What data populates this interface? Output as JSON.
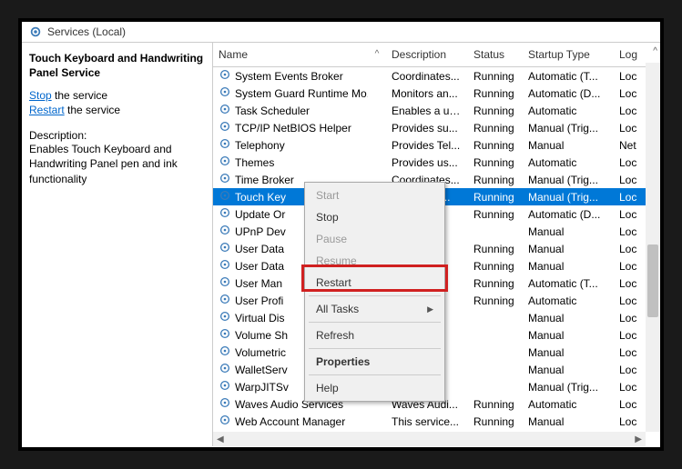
{
  "titlebar": {
    "text": "Services (Local)"
  },
  "leftPane": {
    "serviceTitle": "Touch Keyboard and Handwriting Panel Service",
    "stopLink": "Stop",
    "stopSuffix": " the service",
    "restartLink": "Restart",
    "restartSuffix": " the service",
    "descLabel": "Description:",
    "descText": "Enables Touch Keyboard and Handwriting Panel pen and ink functionality"
  },
  "headers": {
    "name": "Name",
    "description": "Description",
    "status": "Status",
    "startup": "Startup Type",
    "log": "Log"
  },
  "rows": [
    {
      "name": "System Events Broker",
      "desc": "Coordinates...",
      "status": "Running",
      "startup": "Automatic (T...",
      "log": "Loc"
    },
    {
      "name": "System Guard Runtime Mo...",
      "desc": "Monitors an...",
      "status": "Running",
      "startup": "Automatic (D...",
      "log": "Loc"
    },
    {
      "name": "Task Scheduler",
      "desc": "Enables a us...",
      "status": "Running",
      "startup": "Automatic",
      "log": "Loc"
    },
    {
      "name": "TCP/IP NetBIOS Helper",
      "desc": "Provides su...",
      "status": "Running",
      "startup": "Manual (Trig...",
      "log": "Loc"
    },
    {
      "name": "Telephony",
      "desc": "Provides Tel...",
      "status": "Running",
      "startup": "Manual",
      "log": "Net"
    },
    {
      "name": "Themes",
      "desc": "Provides us...",
      "status": "Running",
      "startup": "Automatic",
      "log": "Loc"
    },
    {
      "name": "Time Broker",
      "desc": "Coordinates...",
      "status": "Running",
      "startup": "Manual (Trig...",
      "log": "Loc"
    },
    {
      "name": "Touch Key",
      "desc": "...ides Tou...",
      "status": "Running",
      "startup": "Manual (Trig...",
      "log": "Loc",
      "selected": true
    },
    {
      "name": "Update Or",
      "desc": "es W...",
      "status": "Running",
      "startup": "Automatic (D...",
      "log": "Loc"
    },
    {
      "name": "UPnP Dev",
      "desc": "UPn...",
      "status": "",
      "startup": "Manual",
      "log": "Loc"
    },
    {
      "name": "User Data",
      "desc": "es ap...",
      "status": "Running",
      "startup": "Manual",
      "log": "Loc"
    },
    {
      "name": "User Data",
      "desc": "s sto...",
      "status": "Running",
      "startup": "Manual",
      "log": "Loc"
    },
    {
      "name": "User Man",
      "desc": "ana...",
      "status": "Running",
      "startup": "Automatic (T...",
      "log": "Loc"
    },
    {
      "name": "User Profi",
      "desc": "ice...",
      "status": "Running",
      "startup": "Automatic",
      "log": "Loc"
    },
    {
      "name": "Virtual Dis",
      "desc": "es m...",
      "status": "",
      "startup": "Manual",
      "log": "Loc"
    },
    {
      "name": "Volume Sh",
      "desc": "es an...",
      "status": "",
      "startup": "Manual",
      "log": "Loc"
    },
    {
      "name": "Volumetric",
      "desc": "patia...",
      "status": "",
      "startup": "Manual",
      "log": "Loc"
    },
    {
      "name": "WalletServ",
      "desc": "bjec...",
      "status": "",
      "startup": "Manual",
      "log": "Loc"
    },
    {
      "name": "WarpJITSv",
      "desc": "es a JI...",
      "status": "",
      "startup": "Manual (Trig...",
      "log": "Loc"
    },
    {
      "name": "Waves Audio Services",
      "desc": "Waves Audi...",
      "status": "Running",
      "startup": "Automatic",
      "log": "Loc"
    },
    {
      "name": "Web Account Manager",
      "desc": "This service...",
      "status": "Running",
      "startup": "Manual",
      "log": "Loc"
    }
  ],
  "contextMenu": {
    "start": "Start",
    "stop": "Stop",
    "pause": "Pause",
    "resume": "Resume",
    "restart": "Restart",
    "allTasks": "All Tasks",
    "refresh": "Refresh",
    "properties": "Properties",
    "help": "Help"
  }
}
